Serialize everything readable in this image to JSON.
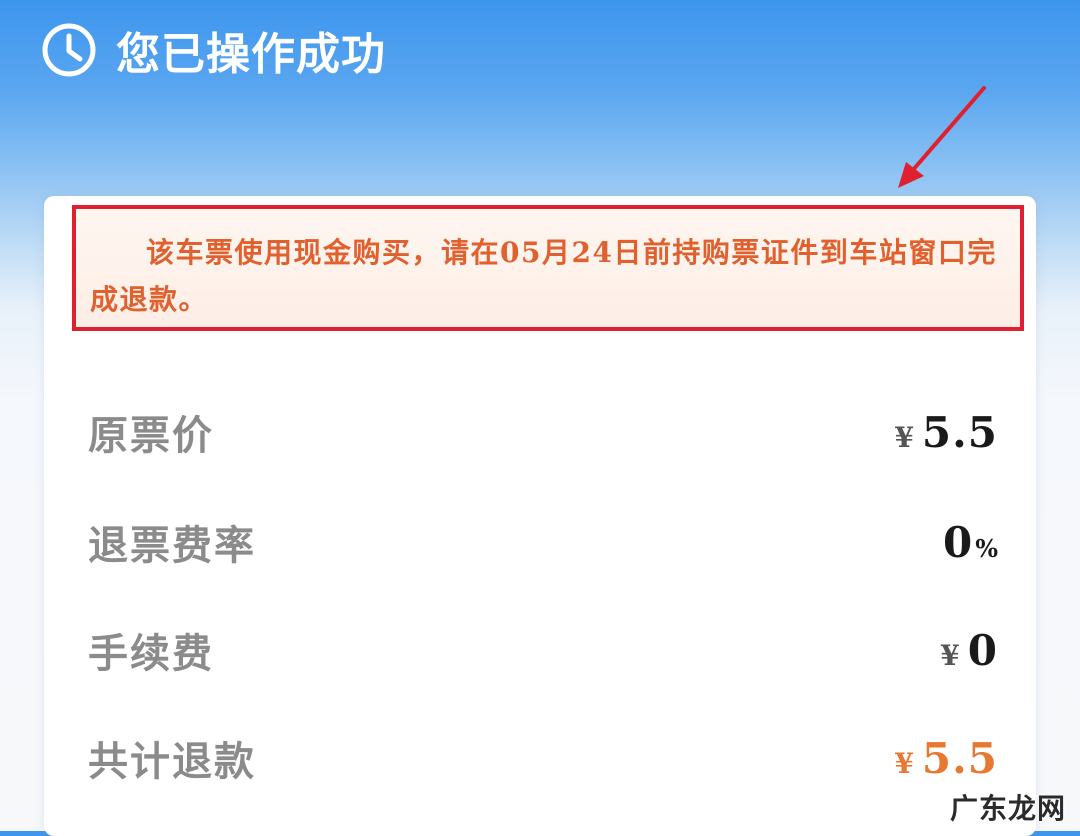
{
  "header": {
    "title": "您已操作成功",
    "icon": "clock-icon",
    "color": "#ffffff"
  },
  "notice": {
    "text": "该车票使用现金购买，请在05月24日前持购票证件到车站窗口完成退款。",
    "highlight_border_color": "#e0202e",
    "text_color": "#e0612e"
  },
  "refund_details": {
    "original_price": {
      "label": "原票价",
      "currency": "¥",
      "amount": "5.5"
    },
    "refund_fee_rate": {
      "label": "退票费率",
      "amount": "0",
      "unit": "%"
    },
    "service_fee": {
      "label": "手续费",
      "currency": "¥",
      "amount": "0"
    },
    "total_refund": {
      "label": "共计退款",
      "currency": "¥",
      "amount": "5.5",
      "color": "#e8772f"
    }
  },
  "watermark": {
    "text": "广东龙网"
  }
}
